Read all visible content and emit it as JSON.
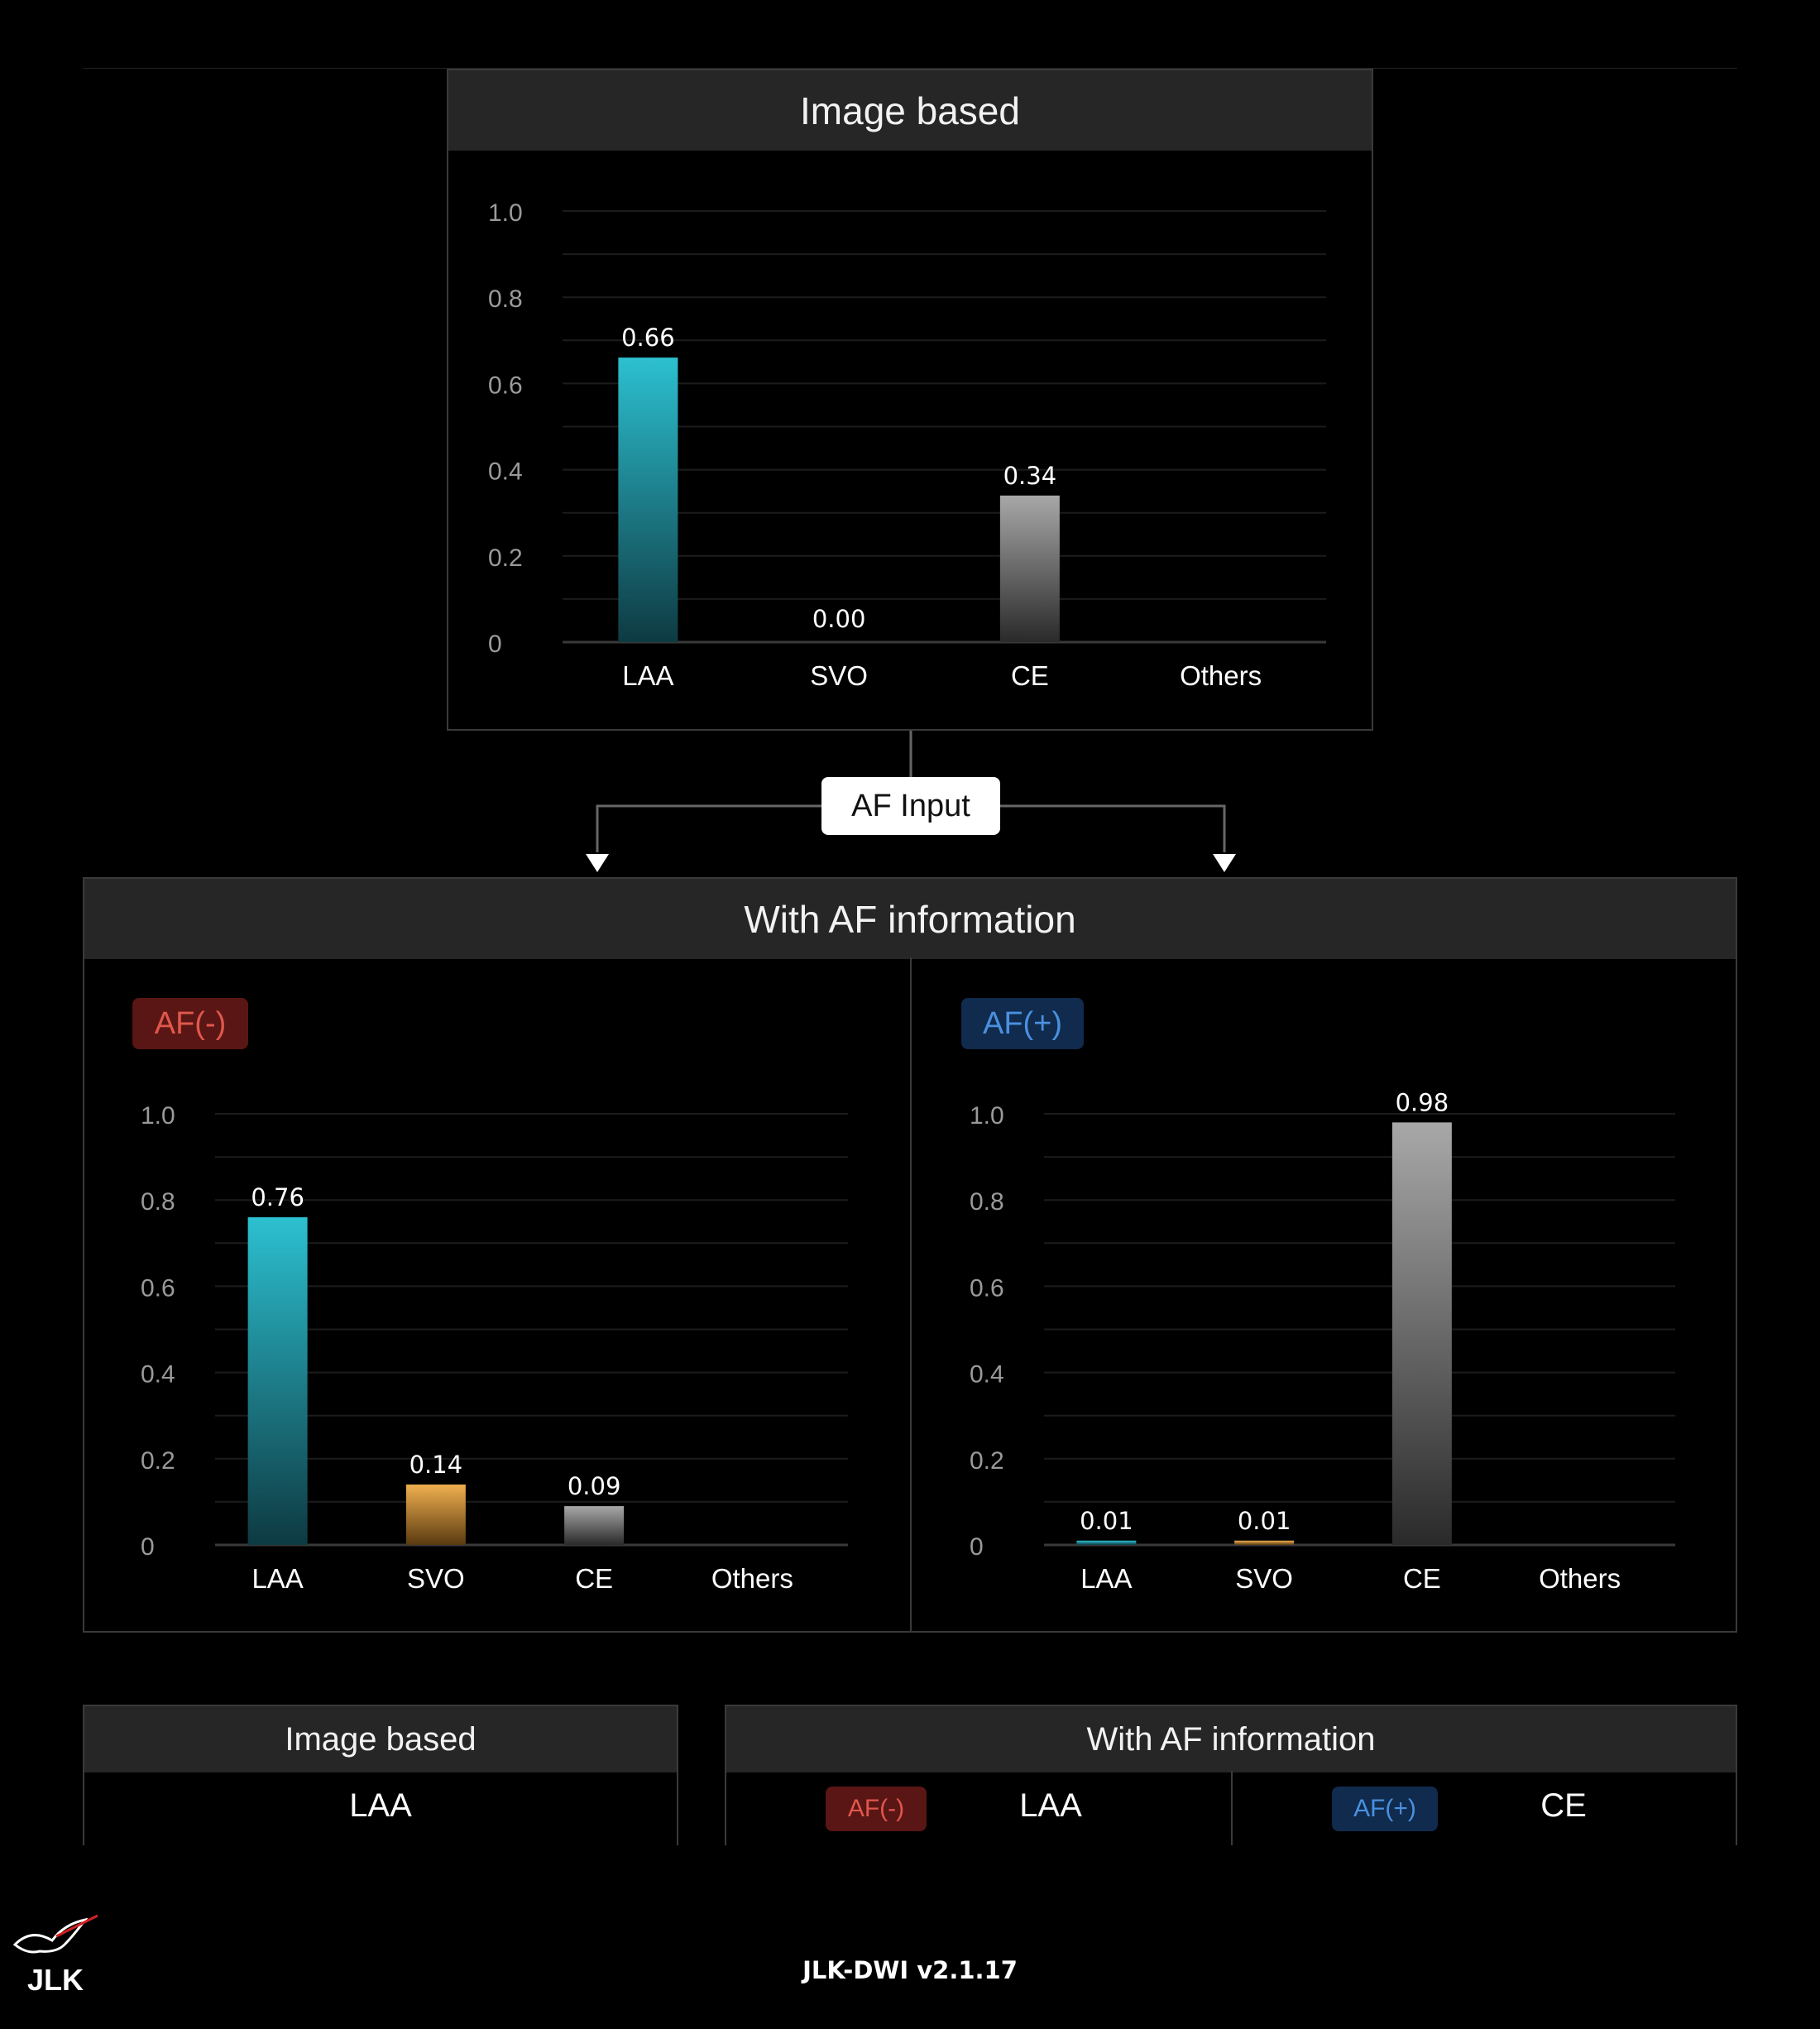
{
  "top": {
    "title": "Image based"
  },
  "af_input": "AF Input",
  "with_af": {
    "title": "With AF information"
  },
  "badges": {
    "neg": "AF(-)",
    "pos": "AF(+)"
  },
  "summary": {
    "image_based_title": "Image based",
    "image_based_result": "LAA",
    "with_af_title": "With AF information",
    "neg_result": "LAA",
    "pos_result": "CE"
  },
  "footer": "JLK-DWI v2.1.17",
  "logo_text": "JLK",
  "colors": {
    "laa": "#2ab8c8",
    "svo": "#e8a94a",
    "ce": "#9a9a9a",
    "neg": "#e0574d",
    "pos": "#4a90e0"
  },
  "chart_data": [
    {
      "id": "image-based",
      "type": "bar",
      "categories": [
        "LAA",
        "SVO",
        "CE",
        "Others"
      ],
      "values": [
        0.66,
        0.0,
        0.34,
        null
      ],
      "value_labels": [
        "0.66",
        "0.00",
        "0.34",
        ""
      ],
      "ylim": [
        0,
        1.0
      ],
      "yticks": [
        "0",
        "0.2",
        "0.4",
        "0.6",
        "0.8",
        "1.0"
      ]
    },
    {
      "id": "af-negative",
      "type": "bar",
      "categories": [
        "LAA",
        "SVO",
        "CE",
        "Others"
      ],
      "values": [
        0.76,
        0.14,
        0.09,
        null
      ],
      "value_labels": [
        "0.76",
        "0.14",
        "0.09",
        ""
      ],
      "ylim": [
        0,
        1.0
      ],
      "yticks": [
        "0",
        "0.2",
        "0.4",
        "0.6",
        "0.8",
        "1.0"
      ]
    },
    {
      "id": "af-positive",
      "type": "bar",
      "categories": [
        "LAA",
        "SVO",
        "CE",
        "Others"
      ],
      "values": [
        0.01,
        0.01,
        0.98,
        null
      ],
      "value_labels": [
        "0.01",
        "0.01",
        "0.98",
        ""
      ],
      "ylim": [
        0,
        1.0
      ],
      "yticks": [
        "0",
        "0.2",
        "0.4",
        "0.6",
        "0.8",
        "1.0"
      ]
    }
  ]
}
